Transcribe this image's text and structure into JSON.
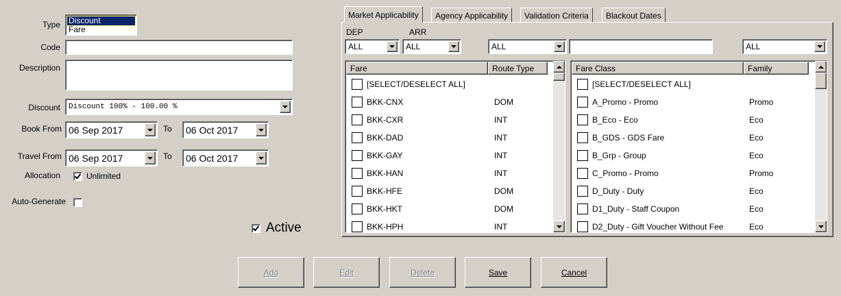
{
  "form": {
    "type_label": "Type",
    "type_options": [
      "Discount",
      "Fare"
    ],
    "code_label": "Code",
    "code_value": "",
    "description_label": "Description",
    "description_value": "",
    "discount_label": "Discount",
    "discount_value": "Discount 100% - 100.00 %",
    "book_from_label": "Book From",
    "book_from_value": "06 Sep 2017",
    "to_label": "To",
    "book_to_value": "06 Oct 2017",
    "travel_from_label": "Travel From",
    "travel_from_value": "06 Sep 2017",
    "travel_to_value": "06 Oct 2017",
    "allocation_label": "Allocation",
    "unlimited_label": "Unlimited",
    "unlimited_checked": true,
    "auto_generate_label": "Auto-Generate",
    "auto_generate_checked": false,
    "active_label": "Active",
    "active_checked": true
  },
  "tabs": [
    "Market Applicability",
    "Agency Applicability",
    "Validation Criteria",
    "Blackout Dates"
  ],
  "filters": {
    "dep_label": "DEP",
    "arr_label": "ARR",
    "dep_value": "ALL",
    "arr_value": "ALL",
    "route_type_value": "ALL",
    "fare_class_filter_value": "",
    "family_value": "ALL"
  },
  "fare_list": {
    "headers": [
      "Fare",
      "Route Type"
    ],
    "rows": [
      {
        "fare": "[SELECT/DESELECT ALL]",
        "route": ""
      },
      {
        "fare": "BKK-CNX",
        "route": "DOM"
      },
      {
        "fare": "BKK-CXR",
        "route": "INT"
      },
      {
        "fare": "BKK-DAD",
        "route": "INT"
      },
      {
        "fare": "BKK-GAY",
        "route": "INT"
      },
      {
        "fare": "BKK-HAN",
        "route": "INT"
      },
      {
        "fare": "BKK-HFE",
        "route": "DOM"
      },
      {
        "fare": "BKK-HKT",
        "route": "DOM"
      },
      {
        "fare": "BKK-HPH",
        "route": "INT"
      }
    ]
  },
  "class_list": {
    "headers": [
      "Fare Class",
      "Family"
    ],
    "rows": [
      {
        "cls": "[SELECT/DESELECT ALL]",
        "family": ""
      },
      {
        "cls": "A_Promo - Promo",
        "family": "Promo"
      },
      {
        "cls": "B_Eco - Eco",
        "family": "Eco"
      },
      {
        "cls": "B_GDS - GDS Fare",
        "family": "Eco"
      },
      {
        "cls": "B_Grp - Group",
        "family": "Eco"
      },
      {
        "cls": "C_Promo - Promo",
        "family": "Promo"
      },
      {
        "cls": "D_Duty - Duty",
        "family": "Eco"
      },
      {
        "cls": "D1_Duty - Staff Coupon",
        "family": "Eco"
      },
      {
        "cls": "D2_Duty - Gift Voucher Without Fee",
        "family": "Eco"
      }
    ]
  },
  "buttons": {
    "add": "Add",
    "edit": "Edit",
    "delete": "Delete",
    "save": "Save",
    "cancel": "Cancel"
  }
}
